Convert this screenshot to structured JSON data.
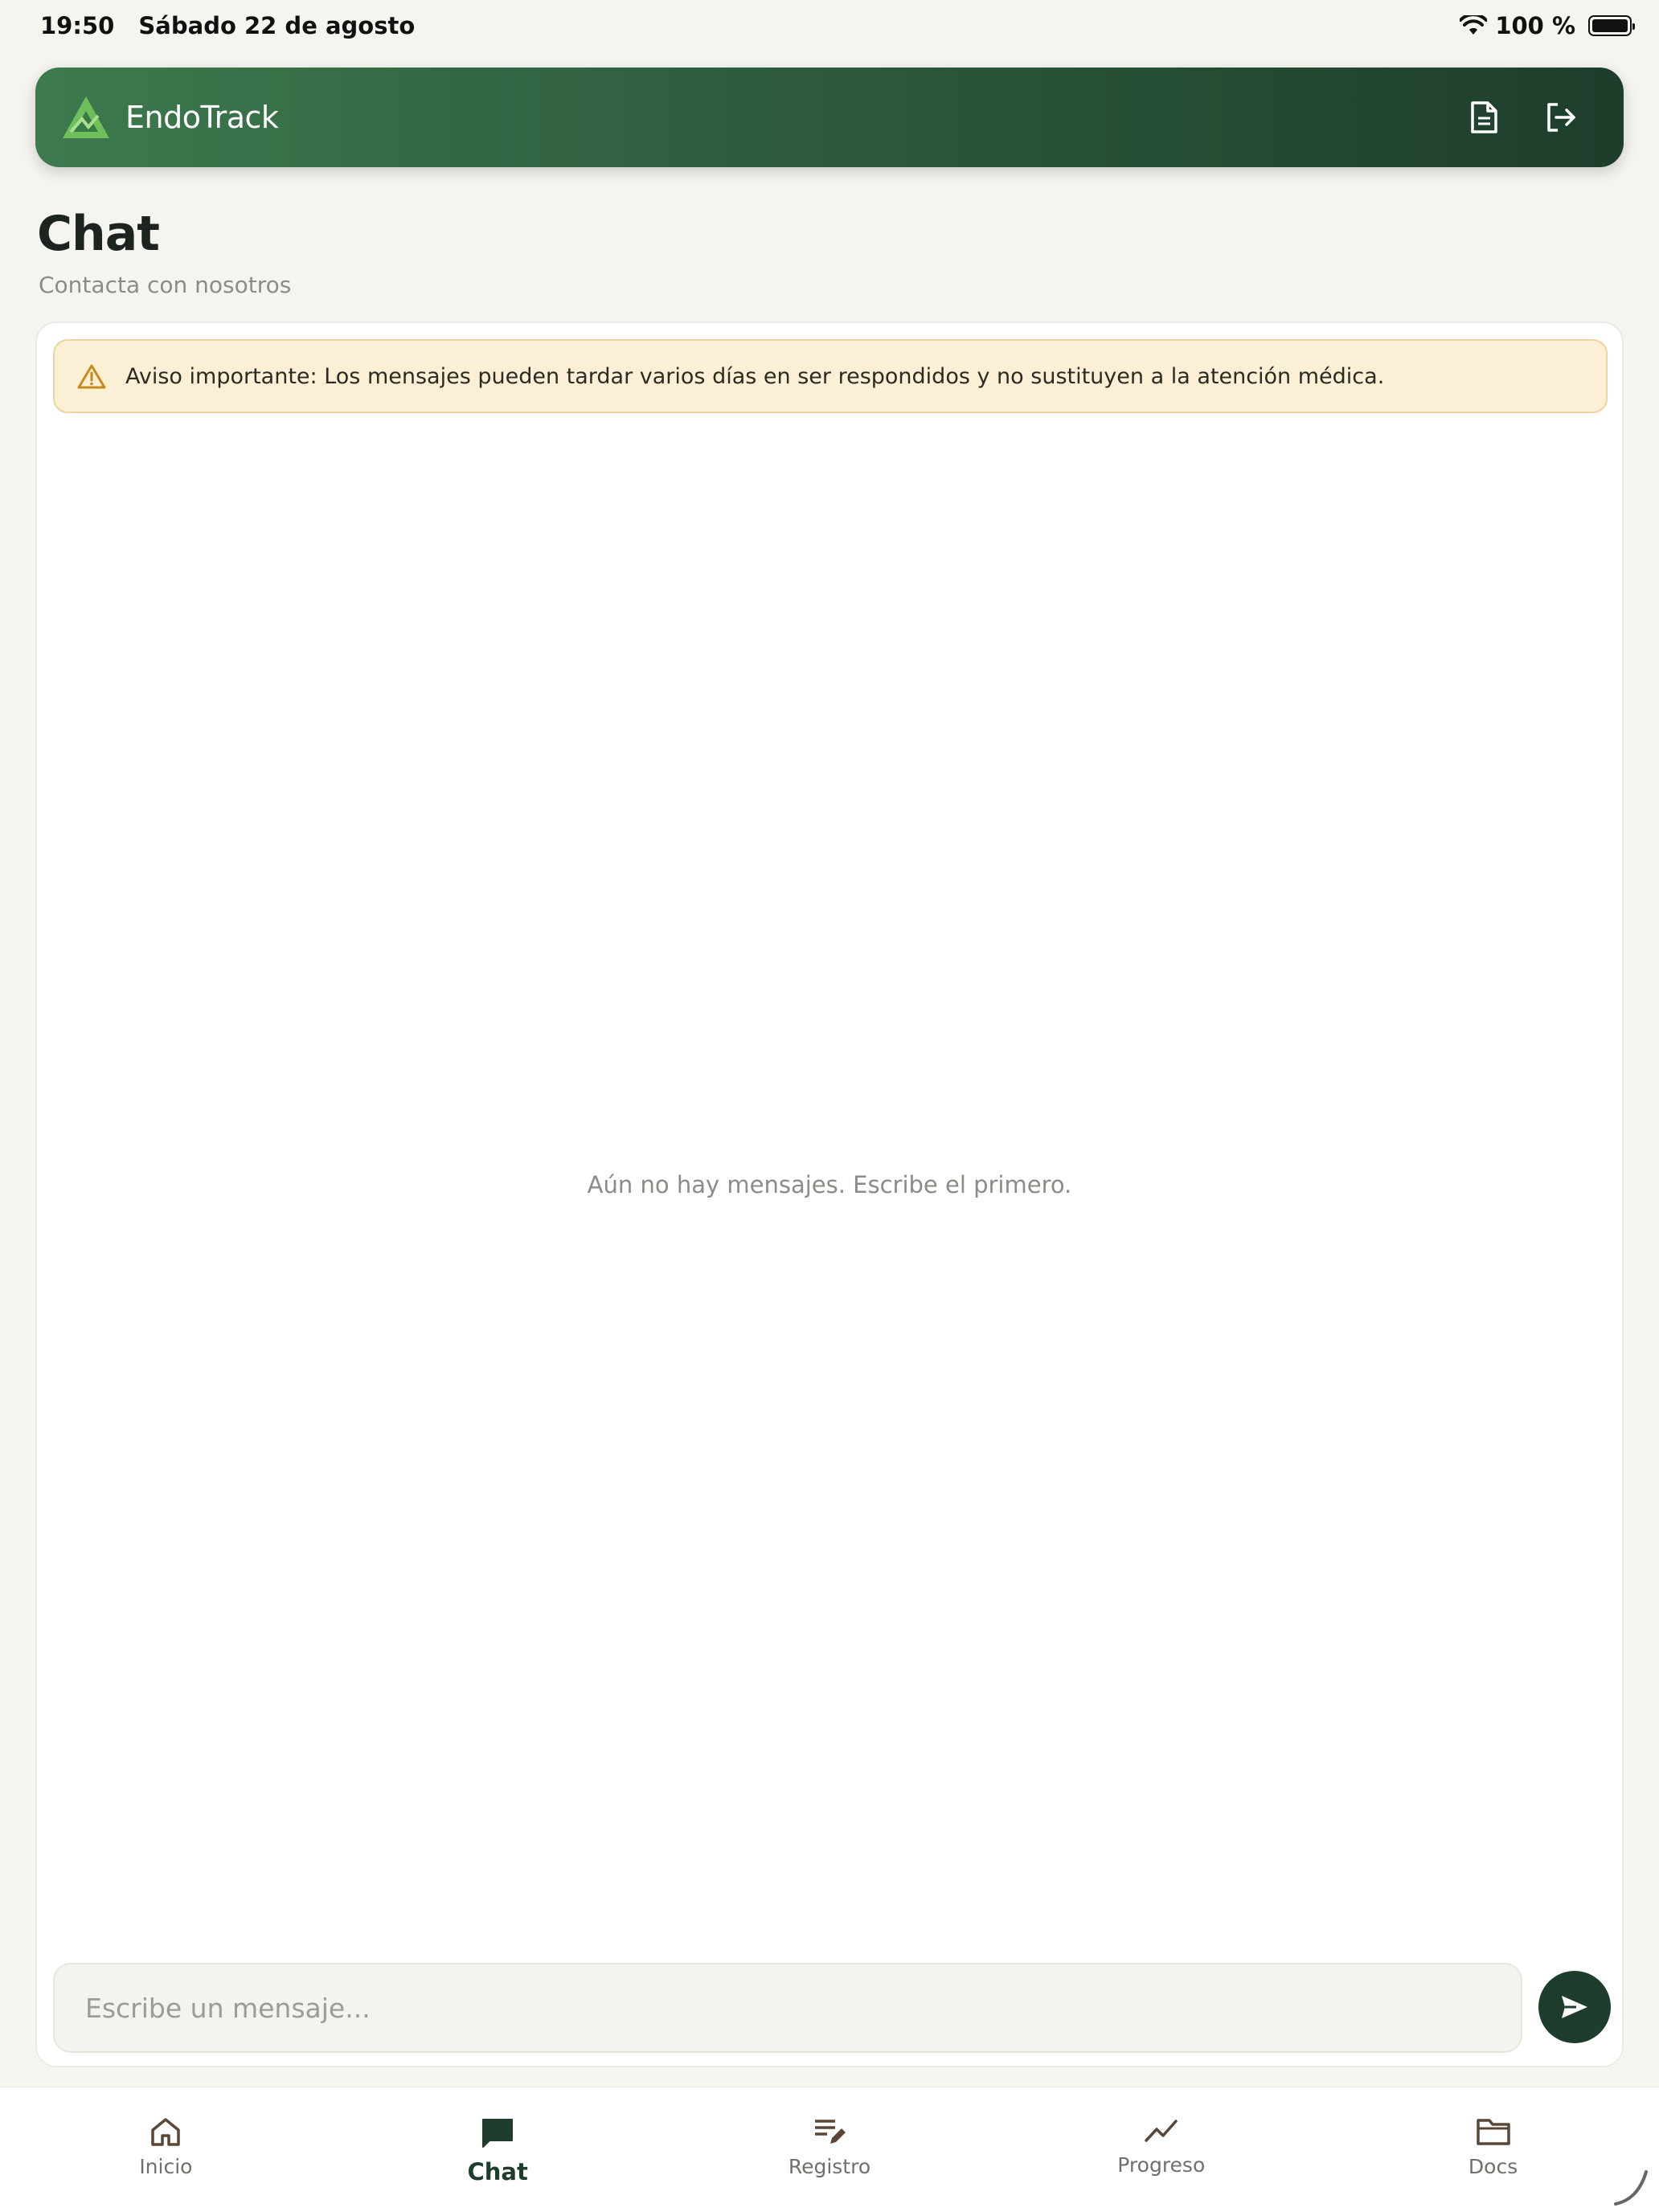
{
  "status_bar": {
    "time": "19:50",
    "date": "Sábado 22 de agosto",
    "battery": "100 %"
  },
  "header": {
    "app_name": "EndoTrack",
    "actions": [
      {
        "icon": "document-icon"
      },
      {
        "icon": "logout-icon"
      }
    ]
  },
  "page": {
    "title": "Chat",
    "subtitle": "Contacta con nosotros"
  },
  "chat": {
    "notice": "Aviso importante: Los mensajes pueden tardar varios días en ser respondidos y no sustituyen a la atención médica.",
    "empty_state": "Aún no hay mensajes. Escribe el primero.",
    "input_placeholder": "Escribe un mensaje...",
    "input_value": ""
  },
  "nav": {
    "items": [
      {
        "label": "Inicio",
        "icon": "home-icon",
        "active": false
      },
      {
        "label": "Chat",
        "icon": "chat-icon",
        "active": true
      },
      {
        "label": "Registro",
        "icon": "edit-list-icon",
        "active": false
      },
      {
        "label": "Progreso",
        "icon": "trend-icon",
        "active": false
      },
      {
        "label": "Docs",
        "icon": "folder-icon",
        "active": false
      }
    ]
  },
  "colors": {
    "brand_dark": "#1e3d2c",
    "brand_light": "#3d7a4e",
    "warning_bg": "#fbefd6",
    "warning_icon": "#c98a1c"
  }
}
